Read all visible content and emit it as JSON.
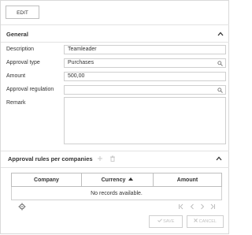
{
  "toolbar": {
    "edit_label": "EDIT"
  },
  "general": {
    "title": "General",
    "fields": [
      {
        "label": "Description",
        "value": "Teamleader"
      },
      {
        "label": "Approval type",
        "value": "Purchases"
      },
      {
        "label": "Amount",
        "value": "500,00"
      },
      {
        "label": "Approval regulation",
        "value": ""
      },
      {
        "label": "Remark",
        "value": ""
      }
    ]
  },
  "rules": {
    "title": "Approval rules per companies",
    "columns": [
      "Company",
      "Currency",
      "Amount"
    ],
    "empty_message": "No records available."
  },
  "footer": {
    "save_label": "SAVE",
    "cancel_label": "CANCEL"
  },
  "colors": {
    "border": "#cfcfcf",
    "disabled": "#c3c3c3",
    "text": "#333333"
  }
}
